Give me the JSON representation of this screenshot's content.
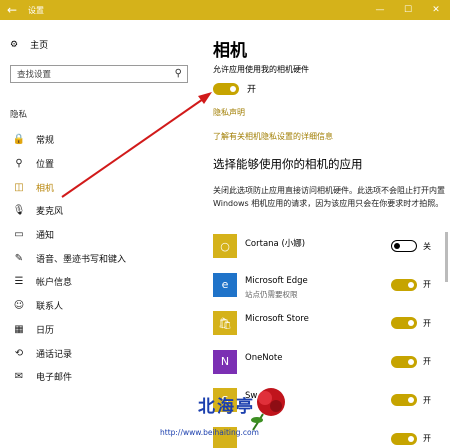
{
  "window": {
    "title": "设置",
    "back_glyph": "←",
    "min_glyph": "—",
    "max_glyph": "☐",
    "close_glyph": "✕"
  },
  "sidebar": {
    "home_label": "主页",
    "search_placeholder": "查找设置",
    "section_label": "隐私",
    "items": [
      {
        "label": "常规",
        "icon": "lock-icon",
        "glyph": "🔒"
      },
      {
        "label": "位置",
        "icon": "location-icon",
        "glyph": "⚲"
      },
      {
        "label": "相机",
        "icon": "camera-icon",
        "glyph": "◫",
        "active": true
      },
      {
        "label": "麦克风",
        "icon": "microphone-icon",
        "glyph": "🎙"
      },
      {
        "label": "通知",
        "icon": "notification-icon",
        "glyph": "▭"
      },
      {
        "label": "语音、墨迹书写和键入",
        "icon": "handwriting-icon",
        "glyph": "✎"
      },
      {
        "label": "帐户信息",
        "icon": "account-info-icon",
        "glyph": "☰"
      },
      {
        "label": "联系人",
        "icon": "contacts-icon",
        "glyph": "☺"
      },
      {
        "label": "日历",
        "icon": "calendar-icon",
        "glyph": "▦"
      },
      {
        "label": "通话记录",
        "icon": "call-history-icon",
        "glyph": "⟲"
      },
      {
        "label": "电子邮件",
        "icon": "email-icon",
        "glyph": "✉"
      }
    ]
  },
  "main": {
    "title": "相机",
    "allow_label": "允许应用使用我的相机硬件",
    "allow_state": "开",
    "privacy_link": "隐私声明",
    "learn_more_link": "了解有关相机隐私设置的详细信息",
    "subheading": "选择能够使用你的相机的应用",
    "description": "关闭此选项防止应用直接访问相机硬件。此选项不会阻止打开内置 Windows 相机应用的请求，因为该应用只会在你要求时才拍照。",
    "apps": [
      {
        "name": "Cortana (小娜)",
        "sub": "",
        "state": "关",
        "on": false,
        "icon": "cortana-icon",
        "color": "#d5b21a",
        "glyph": "○"
      },
      {
        "name": "Microsoft Edge",
        "sub": "站点仍需要权限",
        "state": "开",
        "on": true,
        "icon": "edge-icon",
        "color": "#1f73c9",
        "glyph": "e"
      },
      {
        "name": "Microsoft Store",
        "sub": "",
        "state": "开",
        "on": true,
        "icon": "store-icon",
        "color": "#d5b21a",
        "glyph": "🛍"
      },
      {
        "name": "OneNote",
        "sub": "",
        "state": "开",
        "on": true,
        "icon": "onenote-icon",
        "color": "#7b2fb3",
        "glyph": "N"
      },
      {
        "name": "Sw",
        "sub": "",
        "state": "开",
        "on": true,
        "icon": "sway-icon",
        "color": "#d5b21a",
        "glyph": "S"
      },
      {
        "name": "",
        "sub": "",
        "state": "开",
        "on": true,
        "icon": "app-icon",
        "color": "#d5b21a",
        "glyph": ""
      }
    ]
  },
  "watermark": {
    "text": "北海亭",
    "url": "http://www.beihaiting.com"
  },
  "colors": {
    "accent": "#d5b21a",
    "toggle_on": "#c6a400",
    "link": "#a07d00",
    "arrow": "#d11a1a"
  }
}
